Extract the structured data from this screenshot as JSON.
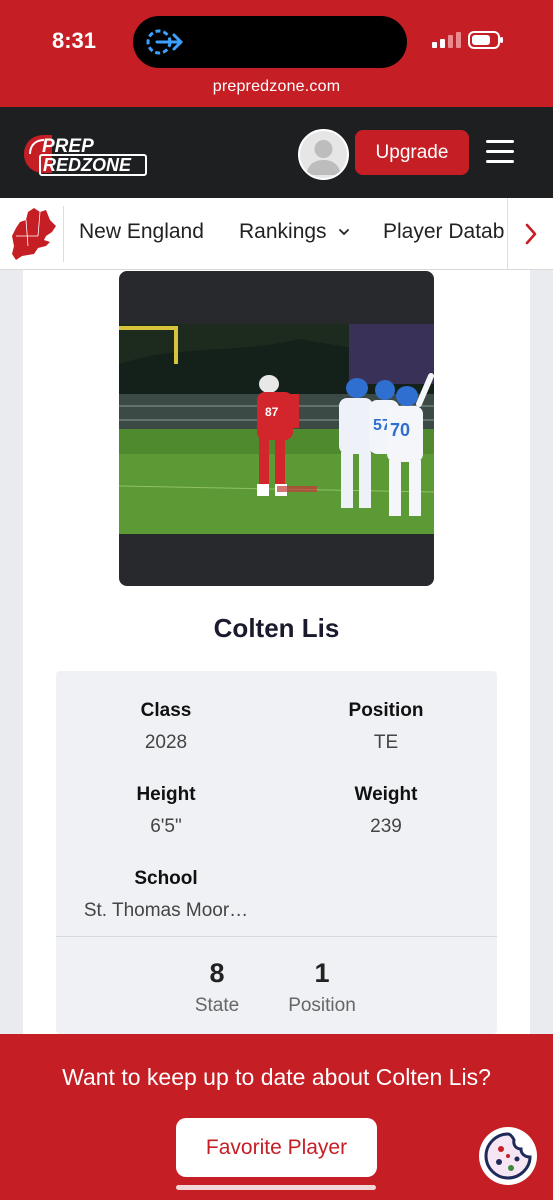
{
  "status_bar": {
    "time": "8:31",
    "url": "prepredzone.com",
    "icons": [
      "back-to-app-icon",
      "signal-icon",
      "battery-icon"
    ]
  },
  "header": {
    "logo_text_top": "PREP",
    "logo_text_bottom": "REDZONE",
    "upgrade_label": "Upgrade",
    "icons": [
      "avatar-icon",
      "hamburger-menu-icon"
    ]
  },
  "nav": {
    "items": [
      {
        "label": "New England"
      },
      {
        "label": "Rankings"
      },
      {
        "label": "Player Datab"
      }
    ],
    "icons": [
      "new-england-map-icon",
      "chevron-down-icon",
      "chevron-right-icon"
    ]
  },
  "player": {
    "name": "Colten Lis",
    "fields": {
      "class": {
        "label": "Class",
        "value": "2028"
      },
      "position": {
        "label": "Position",
        "value": "TE"
      },
      "height": {
        "label": "Height",
        "value": "6'5\""
      },
      "weight": {
        "label": "Weight",
        "value": "239"
      },
      "school": {
        "label": "School",
        "value": "St. Thomas Moor…"
      }
    },
    "rankings": [
      {
        "value": "8",
        "caption": "State"
      },
      {
        "value": "1",
        "caption": "Position"
      }
    ]
  },
  "banner": {
    "text": "Want to keep up to date about Colten Lis?",
    "button_label": "Favorite Player",
    "icons": [
      "cookie-icon"
    ]
  },
  "colors": {
    "brand_red": "#c51f25",
    "header_dark": "#1e1f21",
    "info_bg": "#eff1f4"
  }
}
